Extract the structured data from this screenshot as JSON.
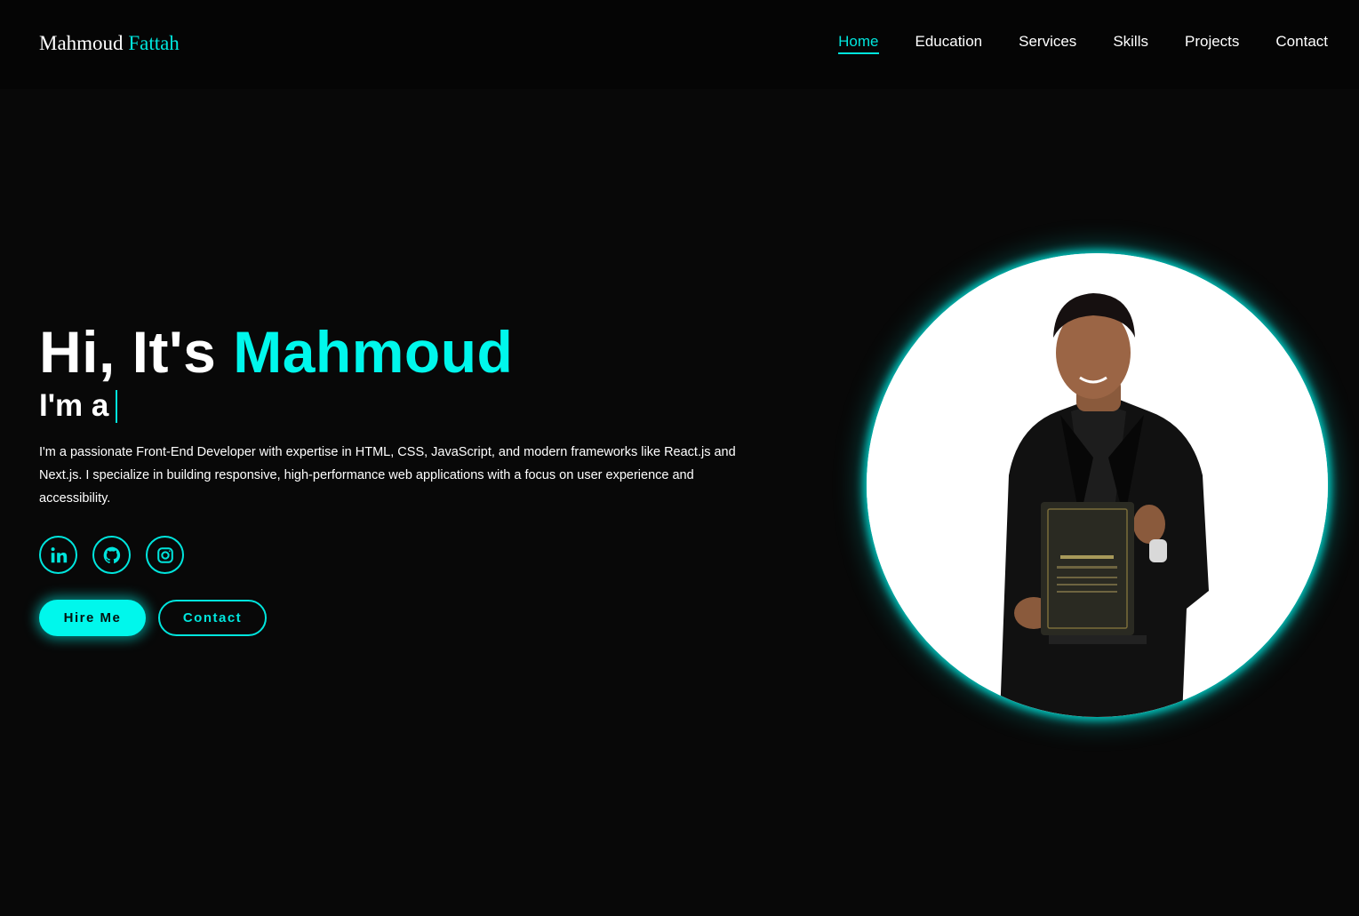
{
  "header": {
    "logo_first": "Mahmoud",
    "logo_last": "Fattah",
    "nav": [
      {
        "label": "Home",
        "active": true
      },
      {
        "label": "Education",
        "active": false
      },
      {
        "label": "Services",
        "active": false
      },
      {
        "label": "Skills",
        "active": false
      },
      {
        "label": "Projects",
        "active": false
      },
      {
        "label": "Contact",
        "active": false
      }
    ]
  },
  "hero": {
    "greeting": "Hi, It's",
    "name": "Mahmoud",
    "role_prefix": "I'm a",
    "bio": "I'm a passionate Front-End Developer with expertise in HTML, CSS, JavaScript, and modern frameworks like React.js and Next.js. I specialize in building responsive, high-performance web applications with a focus on user experience and accessibility.",
    "socials": [
      {
        "name": "linkedin",
        "icon": "linkedin-icon"
      },
      {
        "name": "github",
        "icon": "github-icon"
      },
      {
        "name": "instagram",
        "icon": "instagram-icon"
      }
    ],
    "buttons": {
      "hire": "Hire Me",
      "contact": "Contact"
    }
  },
  "colors": {
    "accent": "#00e5dd",
    "accent_bright": "#00f7ec",
    "background": "#080808",
    "header_background": "#050505"
  }
}
